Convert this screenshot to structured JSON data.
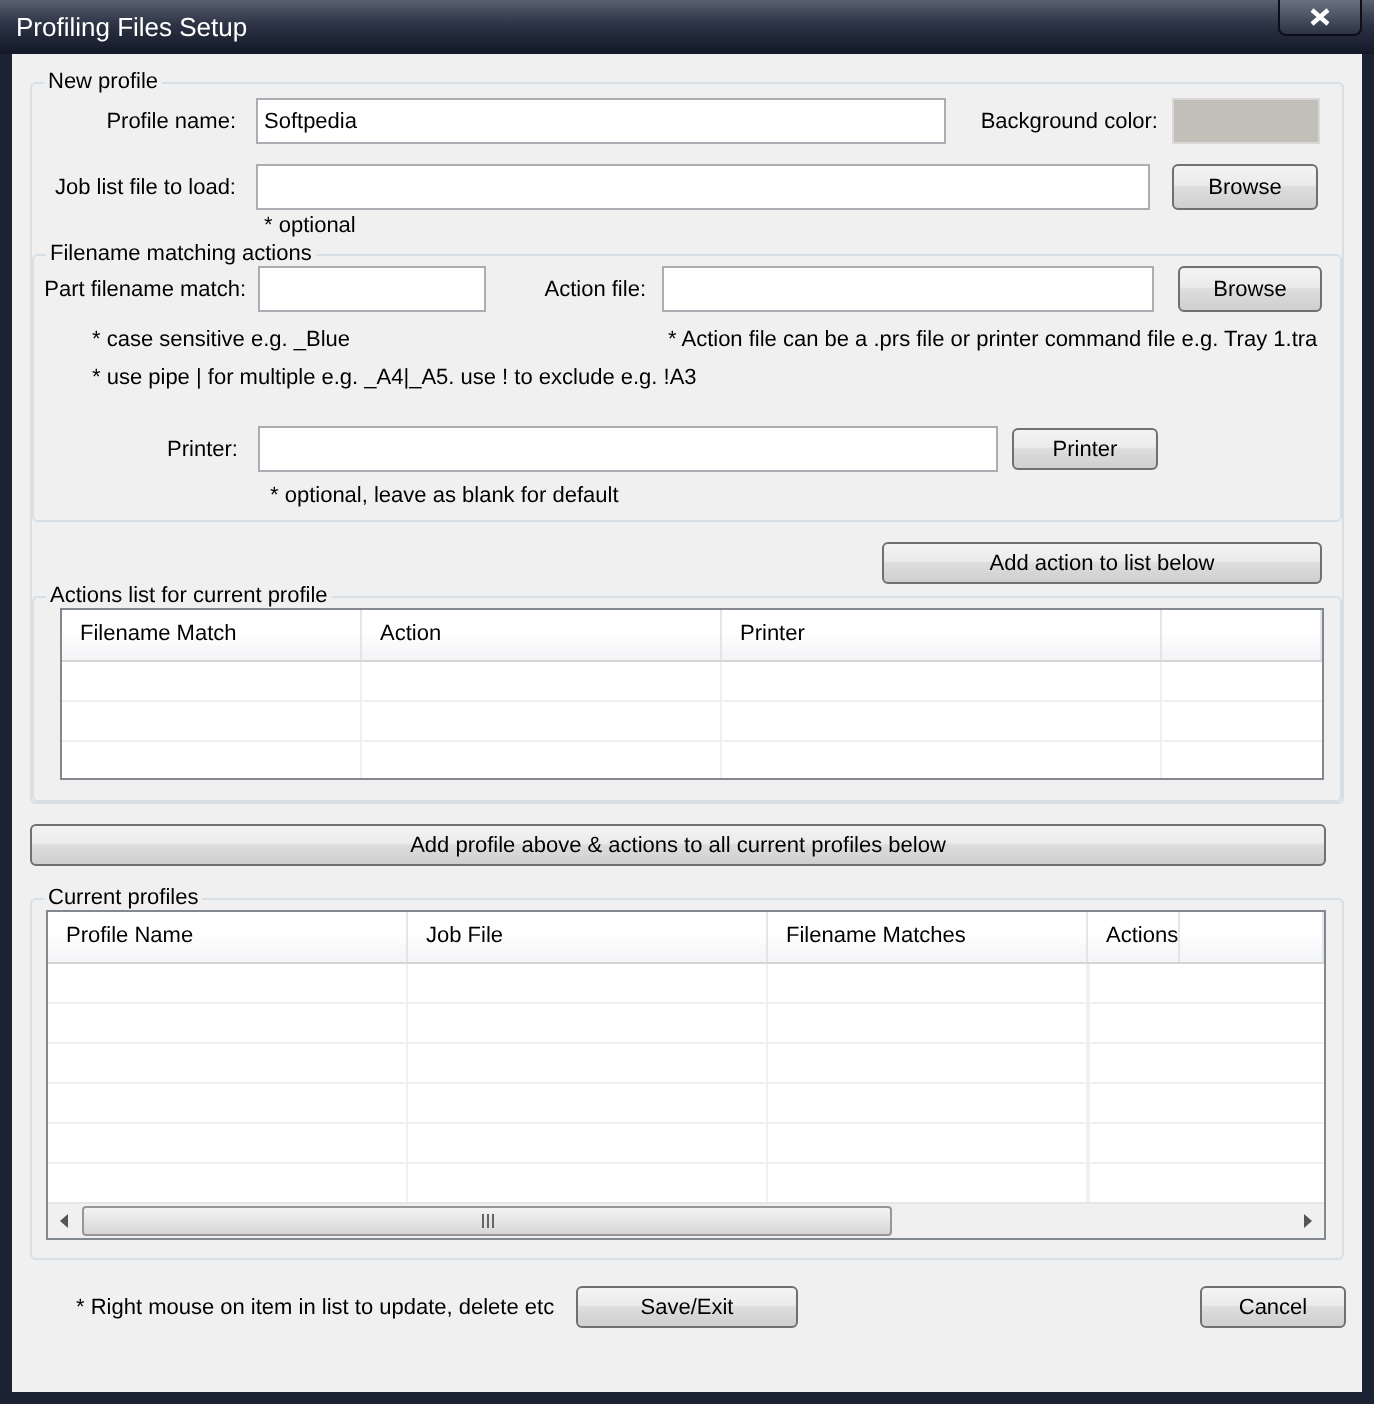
{
  "window": {
    "title": "Profiling Files Setup"
  },
  "new_profile": {
    "legend": "New profile",
    "profile_name": {
      "label": "Profile name:",
      "value": "Softpedia"
    },
    "background_color": {
      "label": "Background color:",
      "color": "#c2bfb9"
    },
    "job_list_file": {
      "label": "Job list file to load:",
      "button": "Browse",
      "hint": "* optional"
    }
  },
  "filename_matching": {
    "legend": "Filename matching actions",
    "part_filename_match": {
      "label": "Part filename match:",
      "hints": [
        "* case sensitive e.g. _Blue",
        "* use pipe | for multiple e.g. _A4|_A5. use ! to exclude e.g. !A3"
      ]
    },
    "action_file": {
      "label": "Action file:",
      "button": "Browse",
      "hint": "* Action file can be a .prs file or printer command file e.g. Tray 1.tra"
    },
    "printer": {
      "label": "Printer:",
      "button": "Printer",
      "hint": "* optional, leave as blank for default"
    }
  },
  "add_action_button": "Add action to list below",
  "actions_list": {
    "legend": "Actions list for current profile",
    "columns": [
      "Filename Match",
      "Action",
      "Printer"
    ]
  },
  "add_profile_button": "Add profile above & actions to all current profiles below",
  "current_profiles": {
    "legend": "Current profiles",
    "columns": [
      "Profile Name",
      "Job File",
      "Filename Matches",
      "Actions"
    ]
  },
  "footer": {
    "hint": "* Right mouse on item in list to update, delete etc",
    "buttons": [
      "Save/Exit",
      "Cancel"
    ]
  }
}
